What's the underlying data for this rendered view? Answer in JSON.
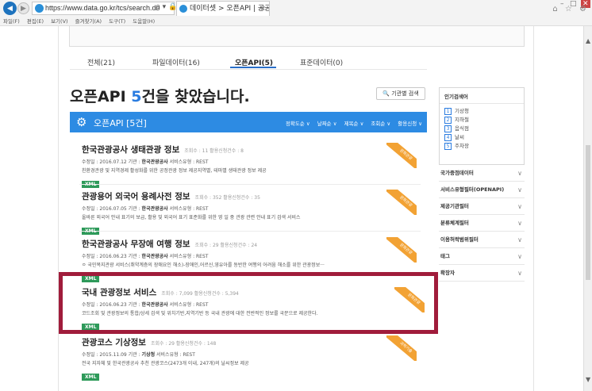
{
  "browser": {
    "url": "https://www.data.go.kr/tcs/search.do",
    "addr_tools": "ρ ▾ 🔒 C",
    "tab_title": "데이터셋 > 오픈API | 공공...",
    "tab_close": "×",
    "menu": [
      "파일(F)",
      "편집(E)",
      "보기(V)",
      "즐겨찾기(A)",
      "도구(T)",
      "도움말(H)"
    ],
    "home_icons": "⌂ ☆ ⚙",
    "win_min": "–",
    "win_max": "□",
    "win_close": "✕"
  },
  "tabs": [
    {
      "label": "전체(21)"
    },
    {
      "label": "파일데이터(16)"
    },
    {
      "label": "오픈API(5)"
    },
    {
      "label": "표준데이터(0)"
    }
  ],
  "heading": {
    "prefix": "오픈API ",
    "count": "5",
    "suffix": "건을 찾았습니다."
  },
  "inst_search_label": "기관별 검색",
  "bluebar": {
    "title": "오픈API [5건]",
    "sorts": [
      "정확도순 ∨",
      "날짜순 ∨",
      "제목순 ∨",
      "조회순 ∨",
      "활용신청 ∨"
    ]
  },
  "items": [
    {
      "title": "한국관광공사 생태관광 정보",
      "meta": "조회수 : 11    활용신청건수 : 8",
      "line_prefix": "수정일 : 2016.07.12   기관 : ",
      "org": "한국관광공사",
      "line_suffix": "   서비스유형 : REST",
      "desc": "친환경관광 및 지역경제 활성화를 위한 공정관광 정보 제공지역별, 테마별 생태관광 정보 제공",
      "badge": "XML",
      "ribbon": "문화관광"
    },
    {
      "title": "관광용어 외국어 용례사전 정보",
      "meta": "조회수 : 352    활용신청건수 : 35",
      "line_prefix": "수정일 : 2016.07.05   기관 : ",
      "org": "한국관광공사",
      "line_suffix": "   서비스유형 : REST",
      "desc": "올바른 외국어 안내 표기의 보급, 활용 및 외국어 표기 표준화를 위한 영 일 중 관광 관련 안내 표기 검색 서비스",
      "badge": "XML",
      "ribbon": "문화관광"
    },
    {
      "title": "한국관광공사 무장애 여행 정보",
      "meta": "조회수 : 29    활용신청건수 : 24",
      "line_prefix": "수정일 : 2016.06.23   기관 : ",
      "org": "한국관광공사",
      "line_suffix": "   서비스유형 : REST",
      "desc": "ㅇ 국민복지관광 서비스(취약계층의 장애요인 해소)-장애인,어르신,영유아를 동반한 여행의 어려움 해소를 위한 관광정보···",
      "badge": "XML",
      "ribbon": "문화관광"
    },
    {
      "title": "국내 관광정보 서비스",
      "meta": "조회수 : 7,099    활용신청건수 : 5,394",
      "line_prefix": "수정일 : 2016.06.23   기관 : ",
      "org": "한국관광공사",
      "line_suffix": "   서비스유형 : REST",
      "desc": "코드조회 및 관광정보의 통합/상세 검색 및 위치기반,지역기반 등 국내 관광에 대한 전반적인 정보를 국문으로 제공한다.",
      "badge": "XML",
      "ribbon": "문화관광"
    },
    {
      "title": "관광코스 기상정보",
      "meta": "조회수 : 29    활용신청건수 : 148",
      "line_prefix": "수정일 : 2015.11.09   기관 : ",
      "org": "기상청",
      "line_suffix": "   서비스유형 : REST",
      "desc": "전국 지자체 및 한국관광공사 추천 관광코스(2473개 이내, 247개)의 날씨정보 제공",
      "badge": "XML",
      "ribbon": "과학기술"
    }
  ],
  "sidebar": {
    "popular_title": "인기검색어",
    "keywords": [
      {
        "num": "1",
        "text": "기상청"
      },
      {
        "num": "2",
        "text": "지하철"
      },
      {
        "num": "3",
        "text": "음식점"
      },
      {
        "num": "4",
        "text": "날씨"
      },
      {
        "num": "5",
        "text": "주차장"
      }
    ],
    "facets": [
      "국가중점데이터",
      "서비스유형필터(OPENAPI)",
      "제공기관필터",
      "분류체계필터",
      "이용허락범위필터",
      "태그",
      "확장자"
    ]
  },
  "colors": {
    "accent_blue": "#2d8be3",
    "highlight_border": "#a01c3b",
    "ribbon_orange": "#f2a234",
    "xml_green": "#2e9a5a"
  }
}
